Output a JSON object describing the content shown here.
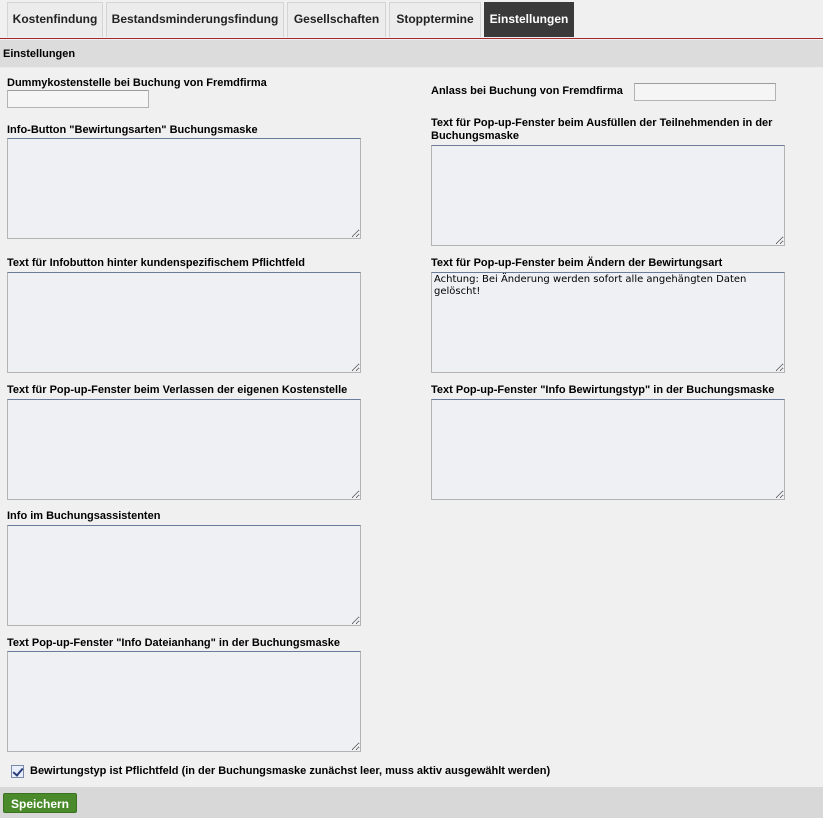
{
  "tabs": [
    {
      "label": "Kostenfindung",
      "active": false
    },
    {
      "label": "Bestandsminderungsfindung",
      "active": false
    },
    {
      "label": "Gesellschaften",
      "active": false
    },
    {
      "label": "Stopptermine",
      "active": false
    },
    {
      "label": "Einstellungen",
      "active": true
    }
  ],
  "section": {
    "title": "Einstellungen"
  },
  "fields": {
    "dummy_kostenstelle": {
      "label": "Dummykostenstelle bei Buchung von Fremdfirma",
      "value": ""
    },
    "anlass": {
      "label": "Anlass bei Buchung von Fremdfirma",
      "value": ""
    },
    "info_bewirtungsarten": {
      "label": "Info-Button \"Bewirtungsarten\" Buchungsmaske",
      "value": ""
    },
    "popup_teilnehmende": {
      "label": "Text für Pop-up-Fenster beim Ausfüllen der Teilnehmenden in der Buchungsmaske",
      "value": ""
    },
    "infobutton_pflichtfeld": {
      "label": "Text für Infobutton hinter kundenspezifischem Pflichtfeld",
      "value": ""
    },
    "popup_aendern_bewirtungsart": {
      "label": "Text für Pop-up-Fenster beim Ändern der Bewirtungsart",
      "value": "Achtung: Bei Änderung werden sofort alle angehängten Daten gelöscht!"
    },
    "popup_verlassen_kostenstelle": {
      "label": "Text für Pop-up-Fenster beim Verlassen der eigenen Kostenstelle",
      "value": ""
    },
    "popup_info_bewirtungstyp": {
      "label": "Text Pop-up-Fenster \"Info Bewirtungstyp\" in der Buchungsmaske",
      "value": ""
    },
    "info_buchungsassistent": {
      "label": "Info im Buchungsassistenten",
      "value": ""
    },
    "popup_info_dateianhang": {
      "label": "Text Pop-up-Fenster \"Info Dateianhang\" in der Buchungsmaske",
      "value": ""
    }
  },
  "checkbox": {
    "label": "Bewirtungstyp ist Pflichtfeld (in der Buchungsmaske zunächst leer, muss aktiv ausgewählt werden)",
    "checked": true
  },
  "footer": {
    "save_label": "Speichern"
  },
  "colors": {
    "accent_line": "#a4282c",
    "active_tab": "#3a3a3a",
    "save_button": "#4a8a2a"
  }
}
